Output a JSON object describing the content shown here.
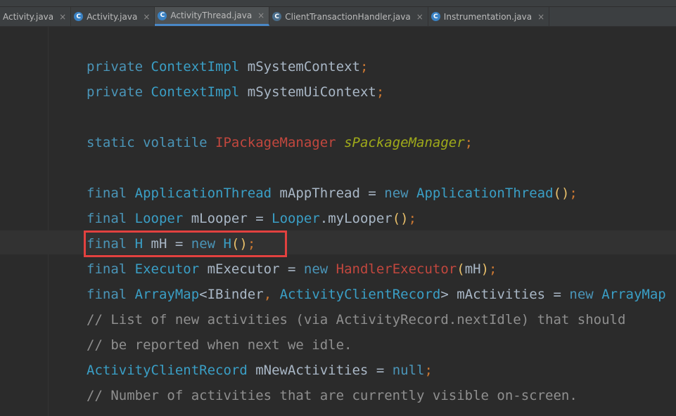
{
  "tabs": [
    {
      "label": "Activity.java",
      "icon": "class-icon",
      "icon_char": "",
      "active": false
    },
    {
      "label": "Activity.java",
      "icon": "class-icon",
      "icon_char": "C",
      "active": false
    },
    {
      "label": "ActivityThread.java",
      "icon": "class-icon",
      "icon_char": "C",
      "active": true
    },
    {
      "label": "ClientTransactionHandler.java",
      "icon": "abstract-class-icon",
      "icon_char": "C",
      "active": false
    },
    {
      "label": "Instrumentation.java",
      "icon": "class-icon",
      "icon_char": "C",
      "active": false
    }
  ],
  "close_glyph": "×",
  "code_lines": [
    [
      {
        "t": "private ",
        "c": "kw"
      },
      {
        "t": "ContextImpl ",
        "c": "ty"
      },
      {
        "t": "mSystemContext",
        "c": "plain"
      },
      {
        "t": ";",
        "c": "pun"
      }
    ],
    [
      {
        "t": "private ",
        "c": "kw"
      },
      {
        "t": "ContextImpl ",
        "c": "ty"
      },
      {
        "t": "mSystemUiContext",
        "c": "plain"
      },
      {
        "t": ";",
        "c": "pun"
      }
    ],
    [],
    [
      {
        "t": "static volatile ",
        "c": "kw"
      },
      {
        "t": "IPackageManager ",
        "c": "red"
      },
      {
        "t": "sPackageManager",
        "c": "field"
      },
      {
        "t": ";",
        "c": "pun"
      }
    ],
    [],
    [
      {
        "t": "final ",
        "c": "kw"
      },
      {
        "t": "ApplicationThread ",
        "c": "ty"
      },
      {
        "t": "mAppThread ",
        "c": "plain"
      },
      {
        "t": "= ",
        "c": "plain"
      },
      {
        "t": "new ",
        "c": "kw"
      },
      {
        "t": "ApplicationThread",
        "c": "ty"
      },
      {
        "t": "()",
        "c": "brk"
      },
      {
        "t": ";",
        "c": "pun"
      }
    ],
    [
      {
        "t": "final ",
        "c": "kw"
      },
      {
        "t": "Looper ",
        "c": "ty"
      },
      {
        "t": "mLooper ",
        "c": "plain"
      },
      {
        "t": "= ",
        "c": "plain"
      },
      {
        "t": "Looper",
        "c": "ty"
      },
      {
        "t": ".myLooper",
        "c": "plain"
      },
      {
        "t": "()",
        "c": "brk"
      },
      {
        "t": ";",
        "c": "pun"
      }
    ],
    [
      {
        "t": "final ",
        "c": "kw"
      },
      {
        "t": "H ",
        "c": "ty"
      },
      {
        "t": "mH ",
        "c": "plain"
      },
      {
        "t": "= ",
        "c": "plain"
      },
      {
        "t": "new ",
        "c": "kw"
      },
      {
        "t": "H",
        "c": "ty"
      },
      {
        "t": "()",
        "c": "brk"
      },
      {
        "t": ";",
        "c": "pun"
      }
    ],
    [
      {
        "t": "final ",
        "c": "kw"
      },
      {
        "t": "Executor ",
        "c": "ty"
      },
      {
        "t": "mExecutor ",
        "c": "plain"
      },
      {
        "t": "= ",
        "c": "plain"
      },
      {
        "t": "new ",
        "c": "kw"
      },
      {
        "t": "HandlerExecutor",
        "c": "red"
      },
      {
        "t": "(",
        "c": "brk"
      },
      {
        "t": "mH",
        "c": "plain"
      },
      {
        "t": ")",
        "c": "brk"
      },
      {
        "t": ";",
        "c": "pun"
      }
    ],
    [
      {
        "t": "final ",
        "c": "kw"
      },
      {
        "t": "ArrayMap",
        "c": "ty"
      },
      {
        "t": "<",
        "c": "plain"
      },
      {
        "t": "IBinder",
        "c": "plain"
      },
      {
        "t": ", ",
        "c": "pun"
      },
      {
        "t": "ActivityClientRecord",
        "c": "ty"
      },
      {
        "t": "> ",
        "c": "plain"
      },
      {
        "t": "mActivities ",
        "c": "plain"
      },
      {
        "t": "= ",
        "c": "plain"
      },
      {
        "t": "new ",
        "c": "kw"
      },
      {
        "t": "ArrayMap",
        "c": "ty"
      }
    ],
    [
      {
        "t": "// List of new activities (via ActivityRecord.nextIdle) that should",
        "c": "cmt"
      }
    ],
    [
      {
        "t": "// be reported when next we idle.",
        "c": "cmt"
      }
    ],
    [
      {
        "t": "ActivityClientRecord ",
        "c": "ty"
      },
      {
        "t": "mNewActivities ",
        "c": "plain"
      },
      {
        "t": "= ",
        "c": "plain"
      },
      {
        "t": "null",
        "c": "kw"
      },
      {
        "t": ";",
        "c": "pun"
      }
    ],
    [
      {
        "t": "// Number of activities that are currently visible on-screen.",
        "c": "cmt"
      }
    ]
  ],
  "highlight_line": 7,
  "colors": {
    "background": "#2b2b2b",
    "keyword": "#4a95b8",
    "type": "#3a9fc6",
    "error_type": "#c2473e",
    "static_field": "#9faa1a",
    "comment": "#8f8f8f",
    "annotation_box": "#e2413f"
  }
}
